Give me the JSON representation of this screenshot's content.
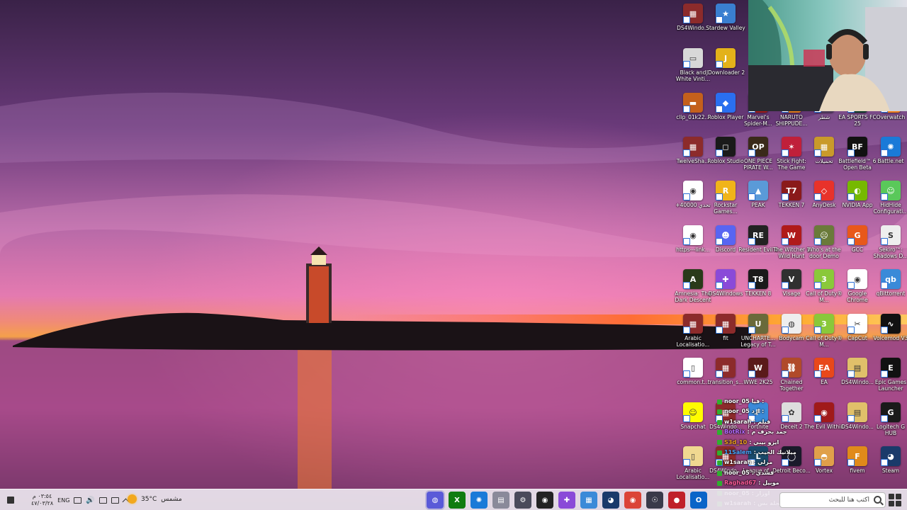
{
  "desktop": {
    "icons": [
      {
        "id": "ds4windows-1",
        "label": "DS4Windo...",
        "glyph": "▦",
        "color": "#8c2b2b",
        "col": 0,
        "row": 0
      },
      {
        "id": "stardew-valley",
        "label": "Stardew Valley",
        "glyph": "★",
        "color": "#3a7fd0",
        "col": 1,
        "row": 0
      },
      {
        "id": "black-white",
        "label": "Black and White Vinti...",
        "glyph": "▭",
        "color": "#d8d8d8",
        "col": 0,
        "row": 1
      },
      {
        "id": "jdownloader",
        "label": "JDownloader 2",
        "glyph": "J",
        "color": "#e3b21a",
        "col": 1,
        "row": 1
      },
      {
        "id": "clip",
        "label": "clip_01k22...",
        "glyph": "▬",
        "color": "#c4601c",
        "col": 0,
        "row": 2
      },
      {
        "id": "roblox-player",
        "label": "Roblox Player",
        "glyph": "◆",
        "color": "#2a6ff0",
        "col": 1,
        "row": 2
      },
      {
        "id": "spider-man",
        "label": "Marvel's Spider-M...",
        "glyph": "✦",
        "color": "#9e1a1a",
        "col": 2,
        "row": 2
      },
      {
        "id": "naruto",
        "label": "NARUTO SHIPPUDE...",
        "glyph": "N",
        "color": "#e07a1a",
        "col": 3,
        "row": 2
      },
      {
        "id": "arabic-1",
        "label": "شطر",
        "glyph": "ش",
        "color": "#4a3a5a",
        "col": 4,
        "row": 2
      },
      {
        "id": "ea-fc25",
        "label": "EA SPORTS FC 25",
        "glyph": "FC",
        "color": "#0d3a2a",
        "col": 5,
        "row": 2
      },
      {
        "id": "overwatch",
        "label": "Overwatch",
        "glyph": "◎",
        "color": "#f0801a",
        "col": 6,
        "row": 2
      },
      {
        "id": "twelve",
        "label": "TwelveSha...",
        "glyph": "▦",
        "color": "#8c2b2b",
        "col": 0,
        "row": 3
      },
      {
        "id": "roblox-studio",
        "label": "Roblox Studio",
        "glyph": "◻",
        "color": "#1a1a1a",
        "col": 1,
        "row": 3
      },
      {
        "id": "one-piece",
        "label": "ONE PIECE PIRATE W...",
        "glyph": "OP",
        "color": "#3a2a1a",
        "col": 2,
        "row": 3
      },
      {
        "id": "stick-fight",
        "label": "Stick Fight: The Game",
        "glyph": "✶",
        "color": "#c0203a",
        "col": 3,
        "row": 3
      },
      {
        "id": "arabic-2",
        "label": "تحميلات",
        "glyph": "▦",
        "color": "#c99a2a",
        "col": 4,
        "row": 3
      },
      {
        "id": "battlefield",
        "label": "Battlefield™ 6 Open Beta",
        "glyph": "BF",
        "color": "#111111",
        "col": 5,
        "row": 3
      },
      {
        "id": "battlenet",
        "label": "Battle.net",
        "glyph": "✺",
        "color": "#1a7ad8",
        "col": 6,
        "row": 3
      },
      {
        "id": "chrome-1",
        "label": "+40000 تحدي",
        "glyph": "◉",
        "color": "#ffffff",
        "col": 0,
        "row": 4
      },
      {
        "id": "rockstar",
        "label": "Rockstar Games...",
        "glyph": "R",
        "color": "#f0b41a",
        "col": 1,
        "row": 4
      },
      {
        "id": "peak",
        "label": "PEAK",
        "glyph": "▲",
        "color": "#5a9ad8",
        "col": 2,
        "row": 4
      },
      {
        "id": "tekken7",
        "label": "TEKKEN 7",
        "glyph": "T7",
        "color": "#8a1a1a",
        "col": 3,
        "row": 4
      },
      {
        "id": "anydesk",
        "label": "AnyDesk",
        "glyph": "◇",
        "color": "#e8322a",
        "col": 4,
        "row": 4
      },
      {
        "id": "nvidia",
        "label": "NVIDIA App",
        "glyph": "◐",
        "color": "#76b900",
        "col": 5,
        "row": 4
      },
      {
        "id": "hidhide",
        "label": "HidHide Configurati...",
        "glyph": "☺",
        "color": "#5ac85a",
        "col": 6,
        "row": 4
      },
      {
        "id": "chrome-2",
        "label": "https---link...",
        "glyph": "◉",
        "color": "#ffffff",
        "col": 0,
        "row": 5
      },
      {
        "id": "discord",
        "label": "Discord",
        "glyph": "☻",
        "color": "#5865f2",
        "col": 1,
        "row": 5
      },
      {
        "id": "resident-evil",
        "label": "Resident Evil 4",
        "glyph": "RE",
        "color": "#222222",
        "col": 2,
        "row": 5
      },
      {
        "id": "witcher",
        "label": "The Witcher 3 Wild Hunt",
        "glyph": "W",
        "color": "#b01a1a",
        "col": 3,
        "row": 5
      },
      {
        "id": "whos-your-daddy",
        "label": "Who's at the door Demo",
        "glyph": "☹",
        "color": "#6a7a3a",
        "col": 4,
        "row": 5
      },
      {
        "id": "gcc",
        "label": "GCC",
        "glyph": "G",
        "color": "#e8581a",
        "col": 5,
        "row": 5
      },
      {
        "id": "sekiro",
        "label": "Sekiro™: Shadows D...",
        "glyph": "S",
        "color": "#eeeeee",
        "col": 6,
        "row": 5
      },
      {
        "id": "amnesia",
        "label": "Amnesia: The Dark Descent",
        "glyph": "A",
        "color": "#2a3a1a",
        "col": 0,
        "row": 6
      },
      {
        "id": "ds4windows-2",
        "label": "DS4Windows",
        "glyph": "✚",
        "color": "#8a4ad8",
        "col": 1,
        "row": 6
      },
      {
        "id": "tekken8",
        "label": "TEKKEN 8",
        "glyph": "T8",
        "color": "#1a1a1a",
        "col": 2,
        "row": 6
      },
      {
        "id": "visage",
        "label": "Visage",
        "glyph": "V",
        "color": "#303030",
        "col": 3,
        "row": 6
      },
      {
        "id": "cod-1",
        "label": "Call of Duty® M...",
        "glyph": "3",
        "color": "#8ac83a",
        "col": 4,
        "row": 6
      },
      {
        "id": "chrome-3",
        "label": "Google Chrome",
        "glyph": "◉",
        "color": "#ffffff",
        "col": 5,
        "row": 6
      },
      {
        "id": "qbittorrent",
        "label": "qBittorrent",
        "glyph": "qb",
        "color": "#3a8ad8",
        "col": 6,
        "row": 6
      },
      {
        "id": "arabic-loc-1",
        "label": "Arabic Localisatio...",
        "glyph": "▦",
        "color": "#8c2b2b",
        "col": 0,
        "row": 7
      },
      {
        "id": "fit",
        "label": "fit",
        "glyph": "▦",
        "color": "#8c2b2b",
        "col": 1,
        "row": 7
      },
      {
        "id": "uncharted",
        "label": "UNCHARTE... Legacy of T...",
        "glyph": "U",
        "color": "#6a6a3a",
        "col": 2,
        "row": 7
      },
      {
        "id": "bodycam",
        "label": "Bodycam",
        "glyph": "◍",
        "color": "#eeeeee",
        "col": 3,
        "row": 7
      },
      {
        "id": "cod-2",
        "label": "Call of Duty® M...",
        "glyph": "3",
        "color": "#8ac83a",
        "col": 4,
        "row": 7
      },
      {
        "id": "capcut",
        "label": "CapCut",
        "glyph": "✂",
        "color": "#ffffff",
        "col": 5,
        "row": 7
      },
      {
        "id": "voicemod",
        "label": "Voicemod V3",
        "glyph": "∿",
        "color": "#111111",
        "col": 6,
        "row": 7
      },
      {
        "id": "common",
        "label": "common.t...",
        "glyph": "▯",
        "color": "#ffffff",
        "col": 0,
        "row": 8
      },
      {
        "id": "transition",
        "label": "transition_s...",
        "glyph": "▦",
        "color": "#8c2b2b",
        "col": 1,
        "row": 8
      },
      {
        "id": "wwe",
        "label": "WWE 2K25",
        "glyph": "W",
        "color": "#5a1a1a",
        "col": 2,
        "row": 8
      },
      {
        "id": "chained",
        "label": "Chained Together",
        "glyph": "⛓",
        "color": "#b04a2a",
        "col": 3,
        "row": 8
      },
      {
        "id": "ea",
        "label": "EA",
        "glyph": "EA",
        "color": "#e8481a",
        "col": 4,
        "row": 8
      },
      {
        "id": "ds4windows-3",
        "label": "DS4Windo...",
        "glyph": "▤",
        "color": "#e0c06a",
        "col": 5,
        "row": 8
      },
      {
        "id": "epic",
        "label": "Epic Games Launcher",
        "glyph": "E",
        "color": "#111111",
        "col": 6,
        "row": 8
      },
      {
        "id": "snapchat",
        "label": "Snapchat",
        "glyph": "☺",
        "color": "#fffc00",
        "col": 0,
        "row": 9
      },
      {
        "id": "ds4windows-4",
        "label": "DS4Windo...",
        "glyph": "▦",
        "color": "#8c2b2b",
        "col": 1,
        "row": 9
      },
      {
        "id": "fortnite",
        "label": "Fortnite",
        "glyph": "F",
        "color": "#3a8ad8",
        "col": 2,
        "row": 9
      },
      {
        "id": "deceit",
        "label": "Deceit 2",
        "glyph": "✿",
        "color": "#dddddd",
        "col": 3,
        "row": 9
      },
      {
        "id": "evil-within",
        "label": "The Evil Within",
        "glyph": "◉",
        "color": "#a01a1a",
        "col": 4,
        "row": 9
      },
      {
        "id": "ds4windows-5",
        "label": "DS4Windo...",
        "glyph": "▤",
        "color": "#e0c06a",
        "col": 5,
        "row": 9
      },
      {
        "id": "logitech",
        "label": "Logitech G HUB",
        "glyph": "G",
        "color": "#1a1a1a",
        "col": 6,
        "row": 9
      },
      {
        "id": "arabic-loc-2",
        "label": "Arabic Localisatio...",
        "glyph": "▯",
        "color": "#f0d890",
        "col": 0,
        "row": 10
      },
      {
        "id": "ds4windows-6",
        "label": "DS4Windo...",
        "glyph": "▦",
        "color": "#8c2b2b",
        "col": 1,
        "row": 10
      },
      {
        "id": "league",
        "label": "League of...",
        "glyph": "L",
        "color": "#1a4a6a",
        "col": 2,
        "row": 10
      },
      {
        "id": "detroit",
        "label": "Detroit Beco...",
        "glyph": "◯",
        "color": "#1a1a2a",
        "col": 3,
        "row": 10
      },
      {
        "id": "vortex",
        "label": "Vortex",
        "glyph": "◓",
        "color": "#e0a04a",
        "col": 4,
        "row": 10
      },
      {
        "id": "fivem",
        "label": "fivem",
        "glyph": "F",
        "color": "#e08a1a",
        "col": 5,
        "row": 10
      },
      {
        "id": "steam",
        "label": "Steam",
        "glyph": "◕",
        "color": "#1a3a6a",
        "col": 6,
        "row": 10
      }
    ]
  },
  "chat": {
    "messages": [
      {
        "user": "noor_05",
        "text": "فيا :",
        "color": "#ffffff",
        "badge": "#2fae2f"
      },
      {
        "user": "noor_05",
        "text": "ارد :",
        "color": "#ffffff",
        "badge": "#2fae2f"
      },
      {
        "user": "w1sarah",
        "text": ": فيلم",
        "color": "#ffffff",
        "badge": "#2fae2f"
      },
      {
        "user": "BotRix",
        "text": ": جمد بحرف م",
        "color": "#b66cff",
        "badge": "#2fae2f"
      },
      {
        "user": "S3d_10",
        "text": ": ايزو بيبي",
        "color": "#f0a020",
        "badge": "#2fae2f"
      },
      {
        "user": "11Salem",
        "text": ": ميلانيك الجيب",
        "color": "#4aa8ff",
        "badge": "#2fae2f"
      },
      {
        "user": "w1sarah",
        "text": ": مرلي",
        "color": "#ffffff",
        "badge": "#2fae2f"
      },
      {
        "user": "noor_05",
        "text": ": قشدي",
        "color": "#ffffff",
        "badge": "#2fae2f"
      },
      {
        "user": "Raghad67",
        "text": ": موبيل",
        "color": "#ff5a9a",
        "badge": "#2fae2f"
      },
      {
        "user": "noor_05",
        "text": ": اوزار",
        "color": "#ffffff",
        "badge": "#2fae2f"
      },
      {
        "user": "w1sarah",
        "text": ": بجلة بس",
        "color": "#ffffff",
        "badge": "#2fae2f"
      }
    ]
  },
  "taskbar": {
    "search_placeholder": "اكتب هنا للبحث",
    "apps": [
      {
        "id": "app-stream",
        "glyph": "◍",
        "color": "#5a5ad8",
        "active": true
      },
      {
        "id": "app-xbox",
        "glyph": "X",
        "color": "#107c10",
        "active": false
      },
      {
        "id": "app-battlenet",
        "glyph": "✺",
        "color": "#1a7ad8",
        "active": false
      },
      {
        "id": "app-explorer",
        "glyph": "▤",
        "color": "#8a8a9a",
        "active": false
      },
      {
        "id": "app-settings",
        "glyph": "⚙",
        "color": "#4a4a5a",
        "active": false
      },
      {
        "id": "app-obs",
        "glyph": "◉",
        "color": "#222222",
        "active": false
      },
      {
        "id": "app-gamepad",
        "glyph": "✚",
        "color": "#8a4ad8",
        "active": false
      },
      {
        "id": "app-store",
        "glyph": "▦",
        "color": "#3a8ad8",
        "active": false
      },
      {
        "id": "app-steam",
        "glyph": "◕",
        "color": "#1a3a6a",
        "active": false
      },
      {
        "id": "app-chrome",
        "glyph": "◉",
        "color": "#db4437",
        "active": false
      },
      {
        "id": "app-discord-overlay",
        "glyph": "☉",
        "color": "#3a3a4a",
        "active": false
      },
      {
        "id": "app-recorder",
        "glyph": "●",
        "color": "#c0202a",
        "active": false
      },
      {
        "id": "app-outlook",
        "glyph": "O",
        "color": "#0a64c8",
        "active": false
      }
    ],
    "weather": {
      "temp": "35°C",
      "condition": "مشمس"
    },
    "language": "ENG",
    "clock": {
      "time": "٠٣:٥٤ م",
      "date": "٤٧/٠٣/٢٨"
    }
  }
}
